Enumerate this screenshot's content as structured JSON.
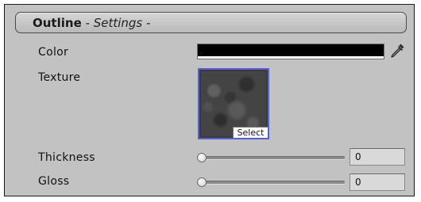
{
  "section": {
    "title": "Outline",
    "dash": " - ",
    "subtitle": "Settings -"
  },
  "color": {
    "label": "Color",
    "value": "#000000",
    "alpha_strip": "#ffffff",
    "picker_icon": "eyedropper-icon"
  },
  "texture": {
    "label": "Texture",
    "select_label": "Select",
    "frame_color": "#4d63d6"
  },
  "thickness": {
    "label": "Thickness",
    "value": "0",
    "slider_fraction": 0
  },
  "gloss": {
    "label": "Gloss",
    "value": "0",
    "slider_fraction": 0
  }
}
